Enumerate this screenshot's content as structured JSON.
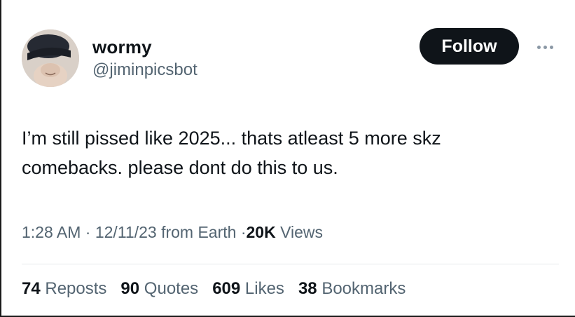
{
  "user": {
    "display_name": "wormy",
    "handle": "@jiminpicsbot",
    "follow_label": "Follow"
  },
  "tweet": {
    "text_line1": "I’m still pissed like 2025... thats atleast 5 more skz",
    "text_line2": "comebacks. please dont do this to us.",
    "time": "1:28 AM",
    "sep": "·",
    "date": "12/11/23",
    "source": "from Earth",
    "views_count": "20K",
    "views_label": "Views"
  },
  "stats": {
    "reposts_count": "74",
    "reposts_label": "Reposts",
    "quotes_count": "90",
    "quotes_label": "Quotes",
    "likes_count": "609",
    "likes_label": "Likes",
    "bookmarks_count": "38",
    "bookmarks_label": "Bookmarks"
  },
  "icons": {
    "more": "more-horizontal-icon"
  },
  "colors": {
    "button_bg": "#0f1419",
    "secondary_text": "#536471",
    "divider": "#e6e9ec"
  }
}
